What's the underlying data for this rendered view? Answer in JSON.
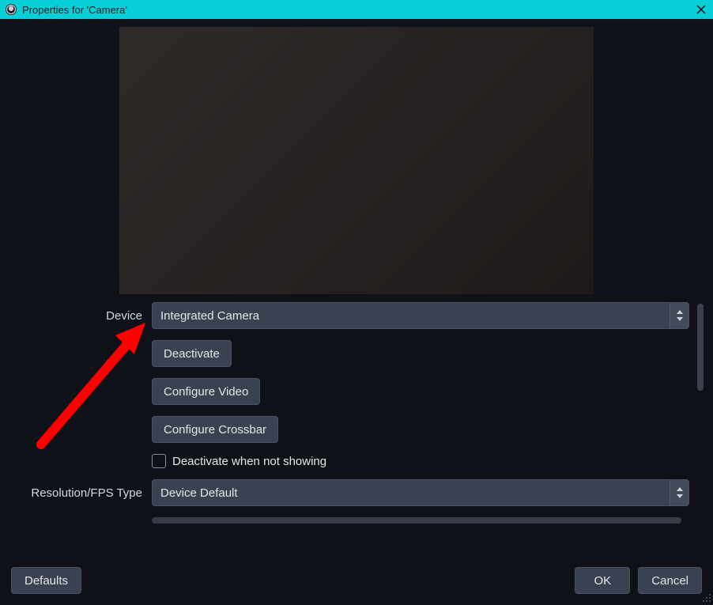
{
  "window": {
    "title": "Properties for 'Camera'"
  },
  "form": {
    "device_label": "Device",
    "device_value": "Integrated Camera",
    "deactivate_btn": "Deactivate",
    "configure_video_btn": "Configure Video",
    "configure_crossbar_btn": "Configure Crossbar",
    "deactivate_when_not_showing_label": "Deactivate when not showing",
    "deactivate_when_not_showing_checked": false,
    "resolution_fps_label": "Resolution/FPS Type",
    "resolution_fps_value": "Device Default"
  },
  "footer": {
    "defaults": "Defaults",
    "ok": "OK",
    "cancel": "Cancel"
  },
  "icons": {
    "app": "obs-icon",
    "close": "close-icon",
    "spin": "updown-icon",
    "grip": "resize-grip-icon"
  },
  "annotation": {
    "type": "arrow",
    "color": "#ff0000",
    "description": "Red arrow pointing to Device dropdown"
  }
}
